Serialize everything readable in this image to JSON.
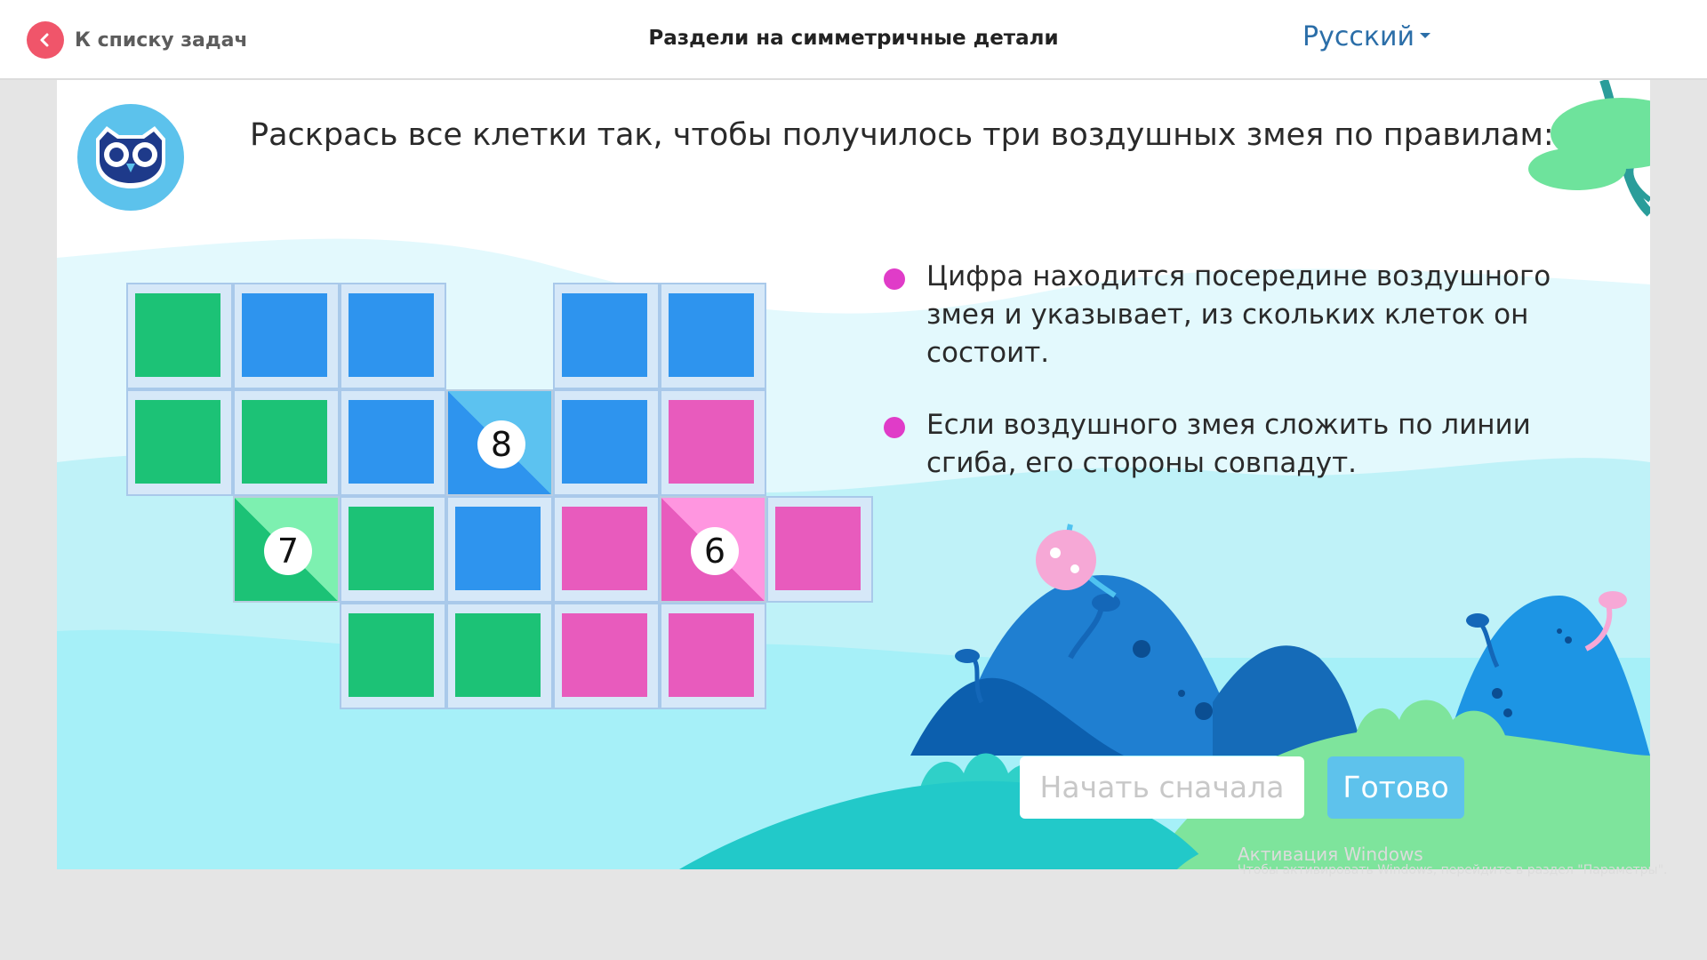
{
  "header": {
    "back_label": "К списку задач",
    "title": "Раздели на симметричные детали",
    "language": "Русский"
  },
  "task": {
    "instruction": "Раскрась все клетки так, чтобы получилось три воздушных змея по правилам:",
    "rules": [
      "Цифра находится посередине воздушного змея и указывает, из скольких клеток он состоит.",
      "Если воздушного змея сложить по линии сгиба, его стороны совпадут."
    ]
  },
  "colors": {
    "green": "#1cc276",
    "blue": "#2e94ee",
    "pink": "#e85bbd",
    "accent": "#f0556a",
    "button_done": "#5ec2ec",
    "rule_dot": "#e03cc8"
  },
  "grid": {
    "rows": [
      [
        "green",
        "blue",
        "blue",
        null,
        "blue",
        "blue",
        null
      ],
      [
        "green",
        "green",
        "blue",
        "seed-8",
        "blue",
        "pink",
        null
      ],
      [
        null,
        "seed-7",
        "green",
        "blue",
        "pink",
        "seed-6",
        "pink"
      ],
      [
        null,
        null,
        "green",
        "green",
        "pink",
        "pink",
        null
      ]
    ],
    "seeds": {
      "seed-8": {
        "number": "8",
        "color": "blue"
      },
      "seed-7": {
        "number": "7",
        "color": "green"
      },
      "seed-6": {
        "number": "6",
        "color": "pink"
      }
    }
  },
  "buttons": {
    "reset": "Начать сначала",
    "done": "Готово"
  },
  "watermark": {
    "title": "Активация Windows",
    "subtitle": "Чтобы активировать Windows, перейдите в раздел \"Параметры\"."
  }
}
